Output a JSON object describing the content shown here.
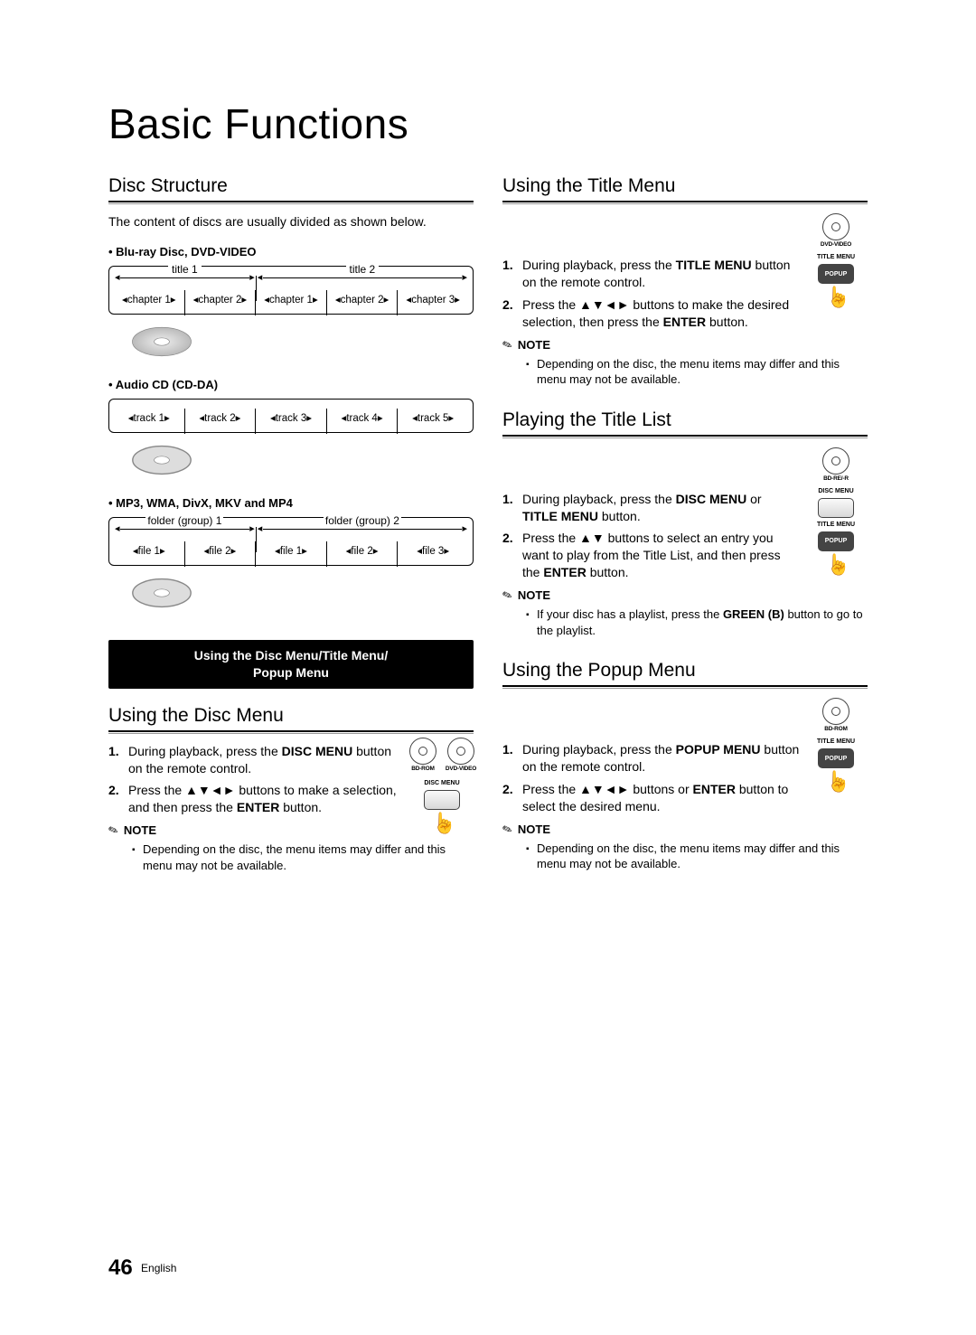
{
  "page": {
    "title": "Basic Functions",
    "number": "46",
    "language": "English"
  },
  "left": {
    "disc_structure": {
      "heading": "Disc Structure",
      "intro": "The content of discs are usually divided as shown below.",
      "bd_dvd_heading": "Blu-ray Disc, DVD-VIDEO",
      "titles": [
        "title 1",
        "title 2"
      ],
      "chapters": [
        "chapter 1",
        "chapter 2",
        "chapter 1",
        "chapter 2",
        "chapter 3"
      ],
      "cd_heading": "Audio CD (CD-DA)",
      "tracks": [
        "track 1",
        "track 2",
        "track 3",
        "track 4",
        "track 5"
      ],
      "mp_heading": "MP3, WMA, DivX, MKV and MP4",
      "folders": [
        "folder (group) 1",
        "folder (group) 2"
      ],
      "files": [
        "file 1",
        "file 2",
        "file 1",
        "file 2",
        "file 3"
      ]
    },
    "black_bar": "Using the Disc Menu/Title Menu/\nPopup Menu",
    "disc_menu": {
      "heading": "Using the Disc Menu",
      "badges": [
        "BD-ROM",
        "DVD-VIDEO"
      ],
      "btn_label_top": "DISC MENU",
      "step1_a": "During playback, press the ",
      "step1_b": "DISC MENU",
      "step1_c": " button on the remote control.",
      "step2_a": "Press the ",
      "step2_arrows": "▲▼◄►",
      "step2_b": " buttons to make a selection, and then press the ",
      "step2_enter": "ENTER",
      "step2_c": " button.",
      "note_head": "NOTE",
      "note1": "Depending on the disc, the menu items may differ and this menu may not be available."
    }
  },
  "right": {
    "title_menu": {
      "heading": "Using the Title Menu",
      "badges": [
        "DVD-VIDEO"
      ],
      "btn_top": "TITLE MENU",
      "btn_popup": "POPUP",
      "step1_a": "During playback, press the ",
      "step1_b": "TITLE MENU",
      "step1_c": " button on the remote control.",
      "step2_a": "Press the ",
      "step2_arrows": "▲▼◄►",
      "step2_b": " buttons to make the desired selection, then press the ",
      "step2_enter": "ENTER",
      "step2_c": " button.",
      "note_head": "NOTE",
      "note1": "Depending on the disc, the menu items may differ and this menu may not be available."
    },
    "title_list": {
      "heading": "Playing the Title List",
      "badges": [
        "BD-RE/-R"
      ],
      "btn_top": "DISC MENU",
      "btn_mid": "TITLE MENU",
      "btn_popup": "POPUP",
      "step1_a": "During playback, press the ",
      "step1_b": "DISC MENU",
      "step1_c": " or ",
      "step1_d": "TITLE MENU",
      "step1_e": " button.",
      "step2_a": "Press the ",
      "step2_arrows": "▲▼",
      "step2_b": " buttons to select an entry you want to play from the Title List, and then press the ",
      "step2_enter": "ENTER",
      "step2_c": " button.",
      "note_head": "NOTE",
      "note1_a": "If your disc has a playlist, press the ",
      "note1_b": "GREEN (B)",
      "note1_c": " button to go to the playlist."
    },
    "popup_menu": {
      "heading": "Using the Popup Menu",
      "badges": [
        "BD-ROM"
      ],
      "btn_top": "TITLE MENU",
      "btn_popup": "POPUP",
      "step1_a": "During playback, press the ",
      "step1_b": "POPUP MENU",
      "step1_c": " button on the remote control.",
      "step2_a": "Press the ",
      "step2_arrows": "▲▼◄►",
      "step2_b": " buttons or ",
      "step2_enter": "ENTER",
      "step2_c": " button to select the desired menu.",
      "note_head": "NOTE",
      "note1": "Depending on the disc, the menu items may differ and this menu may not be available."
    }
  }
}
